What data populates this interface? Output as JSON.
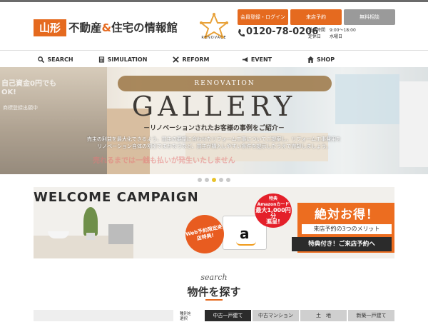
{
  "header": {
    "logo_badge": "山形",
    "logo_text_1": "不動産",
    "logo_amp": "&",
    "logo_text_2": "住宅の情報館",
    "brand_label": "RENOVACE",
    "buttons": {
      "login": "会員登録・ログイン",
      "visit": "来店予約",
      "consult": "無料相談"
    },
    "phone": "0120-78-0206",
    "hours_line1": "受付時間　9:00～18:00",
    "hours_line2": "定休日　　水曜日"
  },
  "nav": {
    "items": [
      {
        "label": "SEARCH",
        "icon": "search-icon"
      },
      {
        "label": "SIMULATION",
        "icon": "calculator-icon"
      },
      {
        "label": "REFORM",
        "icon": "tools-icon"
      },
      {
        "label": "EVENT",
        "icon": "megaphone-icon"
      },
      {
        "label": "SHOP",
        "icon": "shop-icon"
      }
    ]
  },
  "hero": {
    "pill": "RENOVATION",
    "title": "GALLERY",
    "subtitle": "－リノベーションされたお客様の事例をご紹介－",
    "desc_line1": "売主の利益を最大化できるよう、買主の要望に合わせたリフォーム工事についてご提案し、リフォーム工事費用を",
    "desc_line2": "リノベーション自体の割引でまかなうなど、買主が購入しやすい条件を提示したうえで売却しましょう。",
    "ghost_text": "売れるまでは一銭も払いが発生いたしません",
    "left_text": "自己資金0円でもOK!",
    "left_small": "商標登録出願中",
    "slides": 5,
    "active_slide": 3
  },
  "campaign": {
    "title": "WELCOME CAMPAIGN",
    "web_badge": "Web予約限定来店特典!",
    "red_badge_1": "特典",
    "red_badge_2": "Amazonカード",
    "red_badge_3": "最大1,000円分",
    "red_badge_4": "進呈!",
    "amazon_letter": "a",
    "orange_title": "絶対お得！",
    "orange_sub": "来店予約の3つのメリット",
    "cta": "特典付き！ご来店予約へ"
  },
  "search": {
    "en": "search",
    "title": "物件を探す",
    "type_label": "種別を\n選択",
    "tabs": [
      "中古一戸建て",
      "中古マンション",
      "土　地",
      "新築一戸建て"
    ],
    "active_tab": 0
  },
  "colors": {
    "accent": "#e56a1f",
    "dark": "#2b2b2b",
    "gray_button": "#9a9a9a",
    "dot_active": "#e8c22a"
  }
}
